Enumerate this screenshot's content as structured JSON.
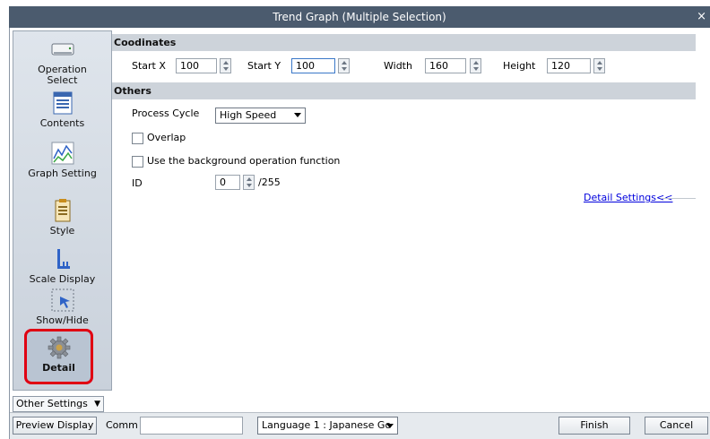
{
  "window": {
    "title": "Trend Graph (Multiple Selection)",
    "close_glyph": "×"
  },
  "sidebar": {
    "items": [
      {
        "label_line1": "Operation",
        "label_line2": "Select",
        "icon": "operation-select-icon"
      },
      {
        "label": "Contents",
        "icon": "contents-icon"
      },
      {
        "label": "Graph Setting",
        "icon": "graph-setting-icon"
      },
      {
        "label": "Style",
        "icon": "style-icon"
      },
      {
        "label": "Scale Display",
        "icon": "scale-display-icon"
      },
      {
        "label": "Show/Hide",
        "icon": "show-hide-icon"
      },
      {
        "label": "Detail",
        "icon": "gear-icon",
        "selected": true
      }
    ],
    "other_settings": "Other Settings"
  },
  "coordinates": {
    "header": "Coodinates",
    "start_x_label": "Start X",
    "start_x": "100",
    "start_y_label": "Start Y",
    "start_y": "100",
    "width_label": "Width",
    "width": "160",
    "height_label": "Height",
    "height": "120"
  },
  "others": {
    "header": "Others",
    "process_cycle_label": "Process Cycle",
    "process_cycle_value": "High Speed",
    "overlap_label": "Overlap",
    "overlap_checked": false,
    "background_label": "Use the background operation function",
    "background_checked": false,
    "id_label": "ID",
    "id_value": "0",
    "id_suffix": "/255",
    "detail_settings_link": "Detail Settings<<"
  },
  "bottom": {
    "preview_display": "Preview Display",
    "comm_label": "Comm",
    "comm_value": "",
    "language_value": "Language 1 : Japanese Go",
    "finish": "Finish",
    "cancel": "Cancel"
  },
  "colors": {
    "selected_outline": "#e00012",
    "title_bar": "#4b5b6e",
    "link": "#0000dd"
  }
}
